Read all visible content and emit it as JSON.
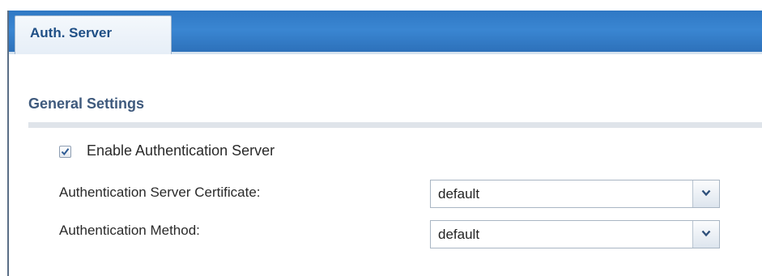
{
  "tabs": [
    {
      "label": "Auth. Server",
      "active": true
    }
  ],
  "section": {
    "title": "General Settings"
  },
  "enable_auth_server": {
    "label": "Enable Authentication Server",
    "checked": true
  },
  "fields": {
    "certificate": {
      "label": "Authentication Server Certificate:",
      "value": "default"
    },
    "method": {
      "label": "Authentication Method:",
      "value": "default"
    }
  },
  "colors": {
    "tab_strip": "#3a86d2",
    "tab_text": "#1f4f86",
    "section_title": "#3f5a7d"
  },
  "icons": {
    "checkbox_mark": "checkmark-icon",
    "dropdown": "chevron-down-icon"
  }
}
